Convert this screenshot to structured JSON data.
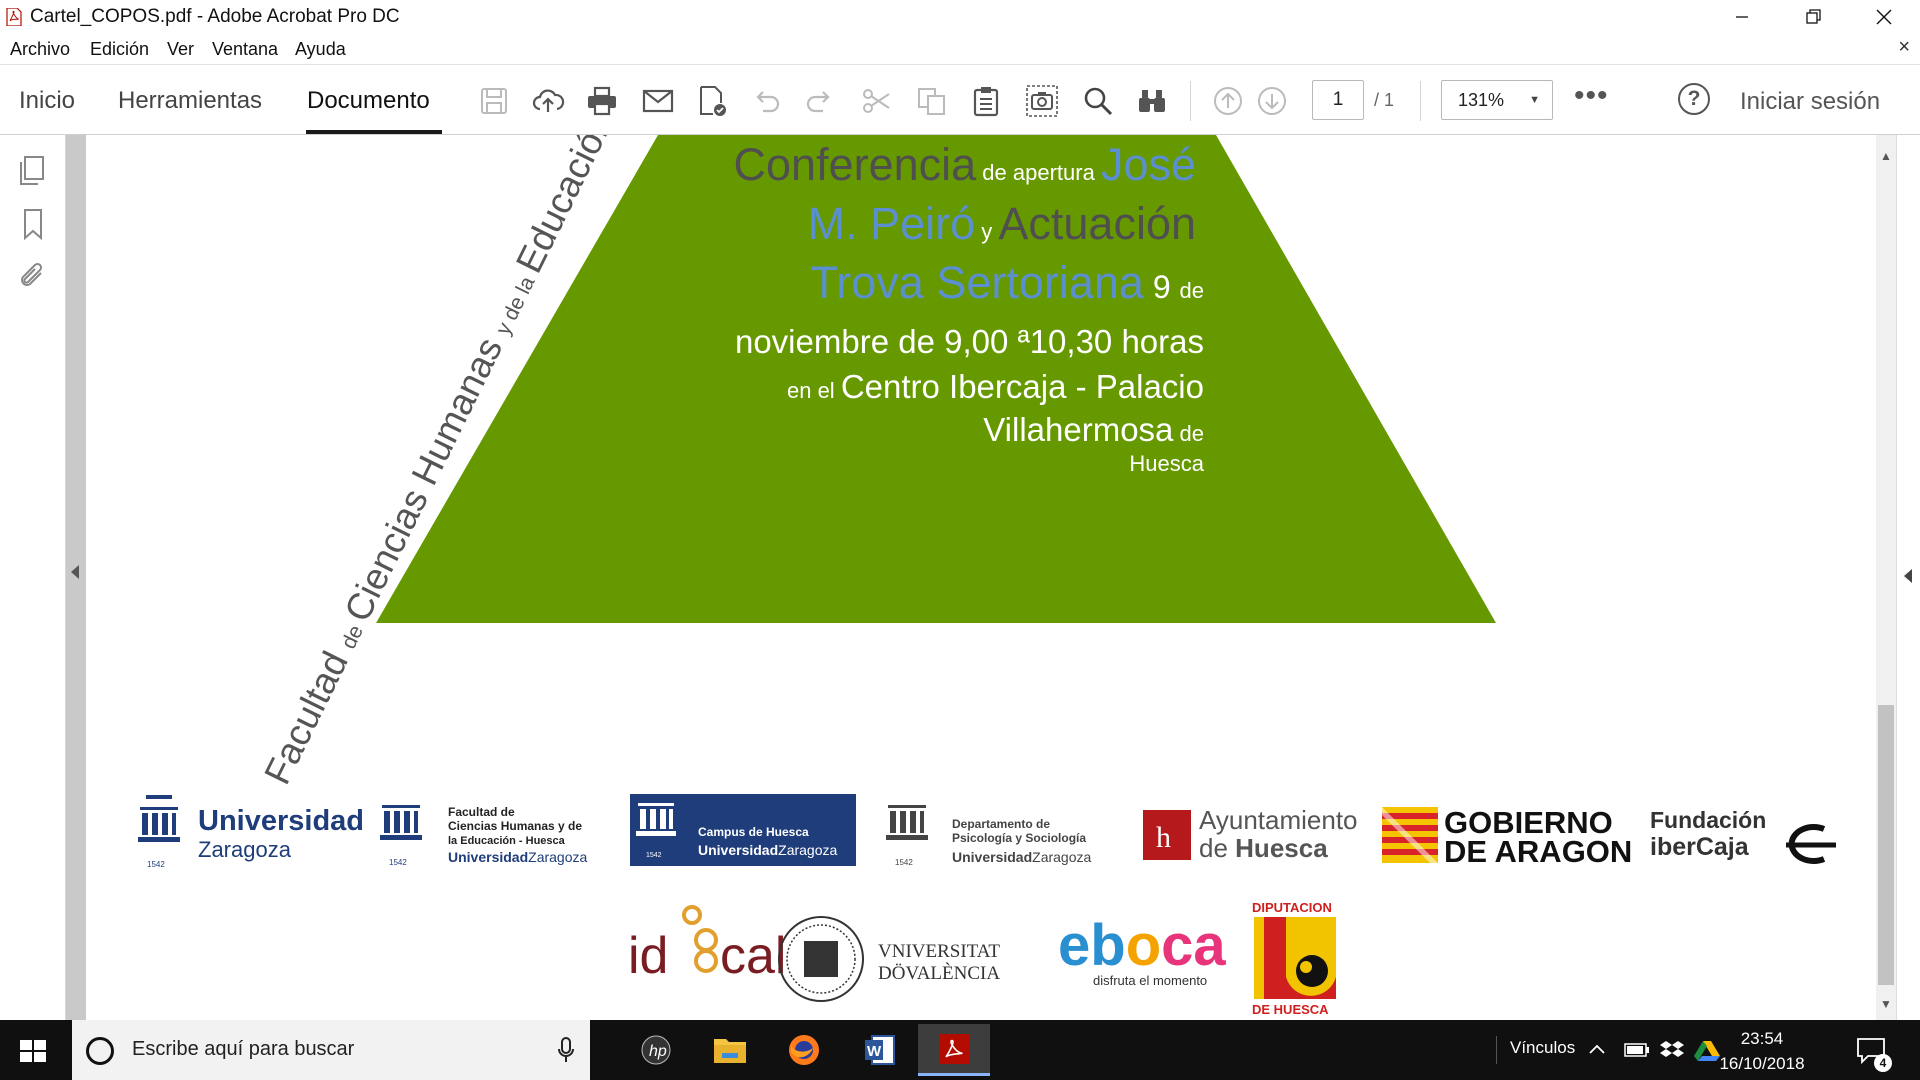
{
  "window": {
    "title": "Cartel_COPOS.pdf - Adobe Acrobat Pro DC"
  },
  "menubar": {
    "items": [
      "Archivo",
      "Edición",
      "Ver",
      "Ventana",
      "Ayuda"
    ],
    "close_doc": "×"
  },
  "toolbar": {
    "tabs": [
      "Inicio",
      "Herramientas",
      "Documento"
    ],
    "active_tab": "Documento",
    "page_current": "1",
    "page_total": "/ 1",
    "zoom": "131%",
    "more": "•••",
    "help": "?",
    "signin": "Iniciar sesión"
  },
  "poster": {
    "vertical_text": "Facultad de Ciencias Humanas y de la Educación de la",
    "lines": [
      [
        "Conferencia",
        " de apertura ",
        "José"
      ],
      [
        "M. Peiró",
        " y ",
        "Actuación"
      ],
      [
        "Trova Sertoriana",
        " 9 ",
        "de"
      ],
      [
        "noviembre de 9,00 ª10,30 horas"
      ],
      [
        "en el ",
        "Centro Ibercaja - Palacio"
      ],
      [
        "Villahermosa",
        " de"
      ],
      [
        "Huesca"
      ]
    ],
    "green": "#669900"
  },
  "logos": {
    "row1": [
      {
        "name": "Universidad",
        "sub": "Zaragoza",
        "year": "1542"
      },
      {
        "line1": "Facultad de",
        "line2": "Ciencias Humanas y de",
        "line3": "la Educación - Huesca",
        "line4": "Universidad",
        "line4b": "Zaragoza",
        "year": "1542"
      },
      {
        "line1": "Campus de Huesca",
        "line2": "Universidad",
        "line2b": "Zaragoza",
        "year": "1542"
      },
      {
        "line1": "Departamento de",
        "line2": "Psicología y Sociología",
        "line3": "Universidad",
        "line3b": "Zaragoza",
        "year": "1542"
      },
      {
        "line1": "Ayuntamiento",
        "line2a": "de ",
        "line2b": "Huesca",
        "mark": "h"
      },
      {
        "line1": "GOBIERNO",
        "line2": "DE ARAGON"
      },
      {
        "line1": "Fundación",
        "line2": "iberCaja"
      }
    ],
    "row2": [
      {
        "text": "idocal"
      },
      {
        "line1": "VNIVERSITAT",
        "line2": "DÖVALÈNCIA"
      },
      {
        "text": "eboca",
        "sub": "disfruta el momento"
      },
      {
        "top": "DIPUTACION",
        "bottom": "DE HUESCA"
      }
    ]
  },
  "taskbar": {
    "search_placeholder": "Escribe aquí para buscar",
    "tray_label": "Vínculos",
    "time": "23:54",
    "date": "16/10/2018",
    "notifications": "4"
  }
}
